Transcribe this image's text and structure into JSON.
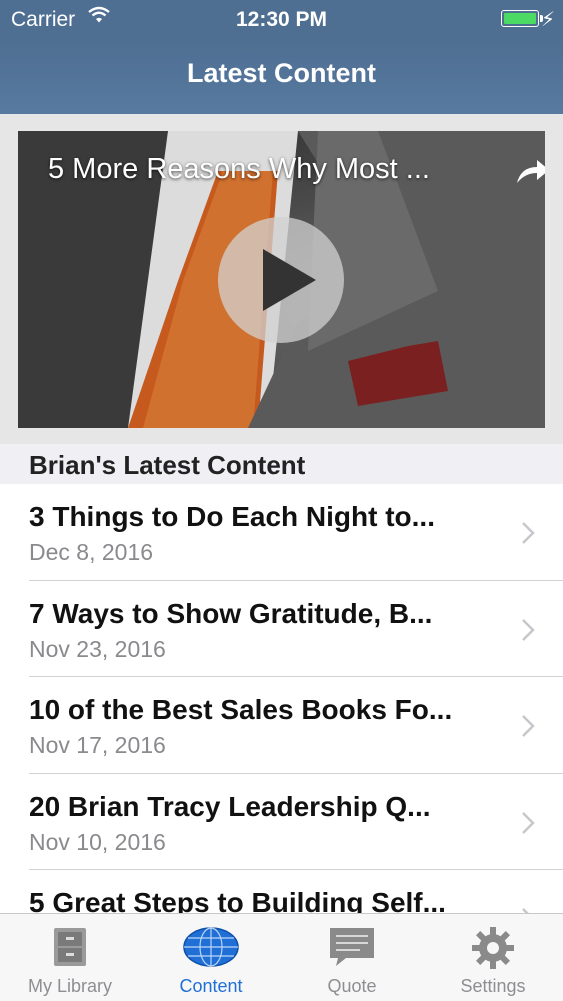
{
  "status_bar": {
    "carrier": "Carrier",
    "time": "12:30 PM"
  },
  "nav": {
    "title": "Latest Content"
  },
  "video": {
    "title": "5 More Reasons Why Most ..."
  },
  "section": {
    "header": "Brian's Latest Content"
  },
  "items": [
    {
      "title": "3 Things to Do Each Night to...",
      "date": "Dec 8, 2016"
    },
    {
      "title": "7 Ways to Show Gratitude, B...",
      "date": "Nov 23, 2016"
    },
    {
      "title": "10 of the Best Sales Books Fo...",
      "date": "Nov 17, 2016"
    },
    {
      "title": "20 Brian Tracy Leadership Q...",
      "date": "Nov 10, 2016"
    },
    {
      "title": "5 Great Steps to Building Self...",
      "date": ""
    }
  ],
  "tabs": [
    {
      "label": "My Library",
      "icon": "cabinet-icon"
    },
    {
      "label": "Content",
      "icon": "globe-icon"
    },
    {
      "label": "Quote",
      "icon": "speech-bubble-icon"
    },
    {
      "label": "Settings",
      "icon": "gear-icon"
    }
  ],
  "colors": {
    "nav": "#4e6e92",
    "active_tab": "#1f6fd6",
    "inactive_tab": "#8e8e93",
    "battery": "#4cd964"
  }
}
